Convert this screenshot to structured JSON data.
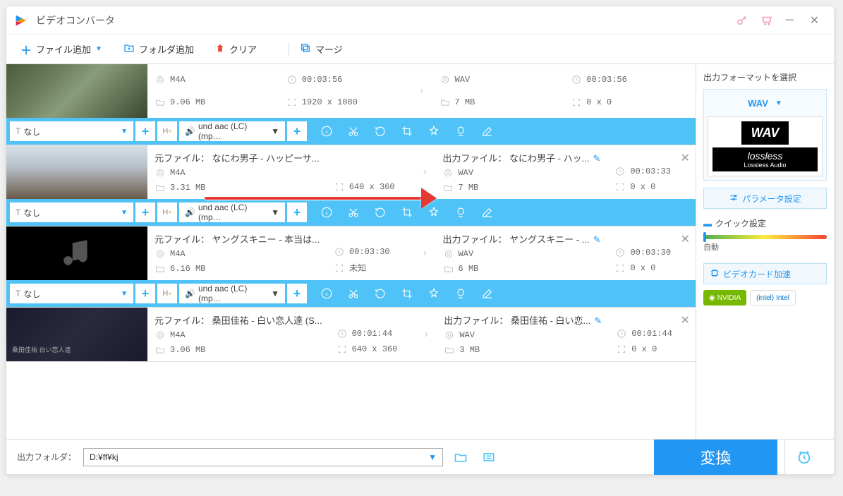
{
  "app": {
    "title": "ビデオコンバータ"
  },
  "toolbar": {
    "add_file": "ファイル追加",
    "add_folder": "フォルダ追加",
    "clear": "クリア",
    "merge": "マージ"
  },
  "items": [
    {
      "src": {
        "format": "M4A",
        "duration": "00:03:56",
        "size": "9.06 MB",
        "res": "1920 x 1080"
      },
      "dst": {
        "format": "WAV",
        "duration": "00:03:56",
        "size": "7 MB",
        "res": "0 x 0"
      },
      "subtitle": "なし",
      "audio": "und aac (LC) (mp…"
    },
    {
      "src_title": "元ファイル： なにわ男子 - ハッピーサ...",
      "dst_title": "出力ファイル： なにわ男子 - ハッ...",
      "src": {
        "format": "M4A",
        "duration": "",
        "size": "3.31 MB",
        "res": "640 x 360"
      },
      "dst": {
        "format": "WAV",
        "duration": "00:03:33",
        "size": "7 MB",
        "res": "0 x 0"
      },
      "subtitle": "なし",
      "audio": "und aac (LC) (mp…"
    },
    {
      "src_title": "元ファイル： ヤングスキニー - 本当は...",
      "dst_title": "出力ファイル： ヤングスキニー - ...",
      "src": {
        "format": "M4A",
        "duration": "00:03:30",
        "size": "6.16 MB",
        "res": "未知"
      },
      "dst": {
        "format": "WAV",
        "duration": "00:03:30",
        "size": "6 MB",
        "res": "0 x 0"
      },
      "subtitle": "なし",
      "audio": "und aac (LC) (mp…"
    },
    {
      "src_title": "元ファイル： 桑田佳祐 - 白い恋人達 (S...",
      "dst_title": "出力ファイル： 桑田佳祐 - 白い恋...",
      "src": {
        "format": "M4A",
        "duration": "00:01:44",
        "size": "3.06 MB",
        "res": "640 x 360"
      },
      "dst": {
        "format": "WAV",
        "duration": "00:01:44",
        "size": "3 MB",
        "res": "0 x 0"
      },
      "thumb_text": "桑田佳祐 白い恋人達"
    }
  ],
  "side": {
    "header": "出力フォーマットを選択",
    "format": "WAV",
    "card_main": "WAV",
    "card_brand": "lossless",
    "card_sub": "Lossless Audio",
    "param_btn": "パラメータ設定",
    "quick": "クイック設定",
    "auto": "自動",
    "gpu": "ビデオカード加速",
    "nvidia": "NVIDIA",
    "intel": "Intel"
  },
  "bottom": {
    "label": "出力フォルダ：",
    "path": "D:¥ff¥kj",
    "convert": "変換"
  }
}
